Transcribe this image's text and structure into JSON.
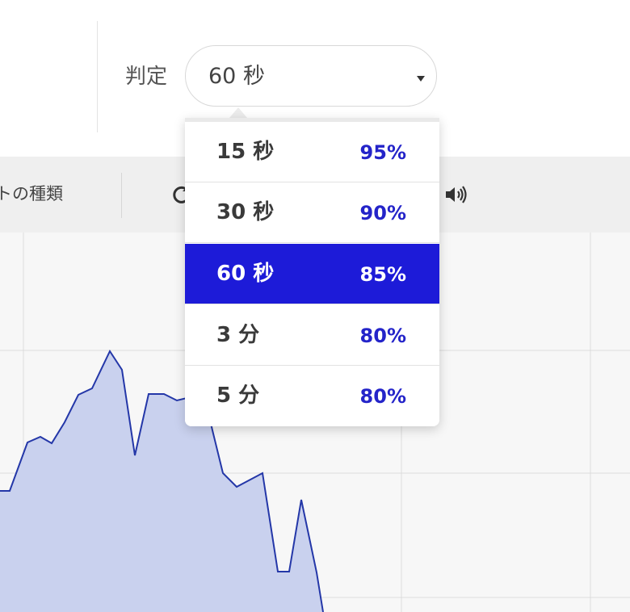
{
  "header": {
    "expiry_label": "判定",
    "expiry_value": "60 秒"
  },
  "toolbar": {
    "chart_type_label": "トの種類",
    "refresh_icon": "refresh-icon",
    "sound_icon": "speaker-icon"
  },
  "dropdown": {
    "options": [
      {
        "time": "15 秒",
        "payout": "95%"
      },
      {
        "time": "30 秒",
        "payout": "90%"
      },
      {
        "time": "60 秒",
        "payout": "85%"
      },
      {
        "time": "3 分",
        "payout": "80%"
      },
      {
        "time": "5 分",
        "payout": "80%"
      }
    ],
    "selected_index": 2
  },
  "colors": {
    "accent": "#1d1bd8",
    "payout_text": "#2424c9",
    "chart_fill": "#c9d1ee",
    "chart_line": "#2437a8"
  }
}
